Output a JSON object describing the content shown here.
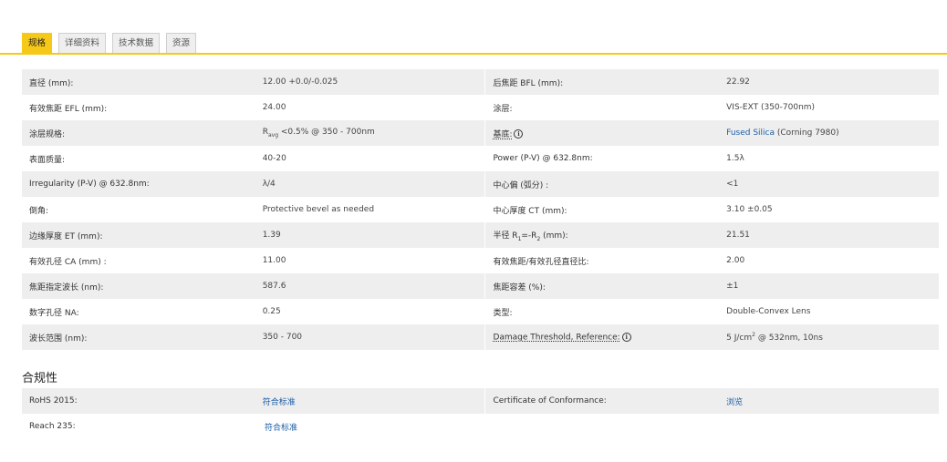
{
  "tabs": [
    "规格",
    "详细资料",
    "技术数据",
    "资源"
  ],
  "accent_color": "#f6c918",
  "specs": [
    {
      "l1": "直径 (mm):",
      "v1": "12.00 +0.0/-0.025",
      "l2": "后焦距 BFL (mm):",
      "v2": "22.92"
    },
    {
      "l1": "有效焦距 EFL (mm):",
      "v1": "24.00",
      "l2": "涂层:",
      "v2": "VIS-EXT (350-700nm)"
    },
    {
      "l1": "涂层规格:",
      "v1_pre": "R",
      "v1_sub": "avg",
      "v1_post": " <0.5% @ 350 - 700nm",
      "l2": "基底:",
      "v2_link": "Fused Silica",
      "v2_post": " (Corning 7980)"
    },
    {
      "l1": "表面质量:",
      "v1": "40-20",
      "l2": "Power (P-V) @ 632.8nm:",
      "v2": "1.5λ"
    },
    {
      "l1": "Irregularity (P-V) @ 632.8nm:",
      "v1": "λ/4",
      "l2": "中心偏 (弧分) :",
      "v2": "<1"
    },
    {
      "l1": "倒角:",
      "v1": "Protective bevel as needed",
      "l2": "中心厚度 CT (mm):",
      "v2": "3.10 ±0.05"
    },
    {
      "l1": "边缘厚度 ET (mm):",
      "v1": "1.39",
      "l2_pre": "半径 R",
      "l2_sub1": "1",
      "l2_mid": "=-R",
      "l2_sub2": "2",
      "l2_post": " (mm):",
      "v2": "21.51"
    },
    {
      "l1": "有效孔径 CA (mm) :",
      "v1": "11.00",
      "l2": "有效焦距/有效孔径直径比:",
      "v2": "2.00"
    },
    {
      "l1": "焦距指定波长 (nm):",
      "v1": "587.6",
      "l2": "焦距容差 (%):",
      "v2": "±1"
    },
    {
      "l1": "数字孔径 NA:",
      "v1": "0.25",
      "l2": "类型:",
      "v2": "Double-Convex Lens"
    },
    {
      "l1": "波长范围 (nm):",
      "v1": "350 - 700",
      "l2": "Damage Threshold, Reference:",
      "v2_pre": "5 J/cm",
      "v2_sup": "2",
      "v2_post": " @ 532nm, 10ns"
    }
  ],
  "compliance": {
    "title": "合规性",
    "rows": [
      {
        "l1": "RoHS 2015:",
        "v1": "符合标准",
        "l2": "Certificate of Conformance:",
        "v2": "浏览"
      },
      {
        "l1": "Reach 235:",
        "v1": "符合标准"
      }
    ]
  },
  "icons": {
    "info": "i"
  }
}
